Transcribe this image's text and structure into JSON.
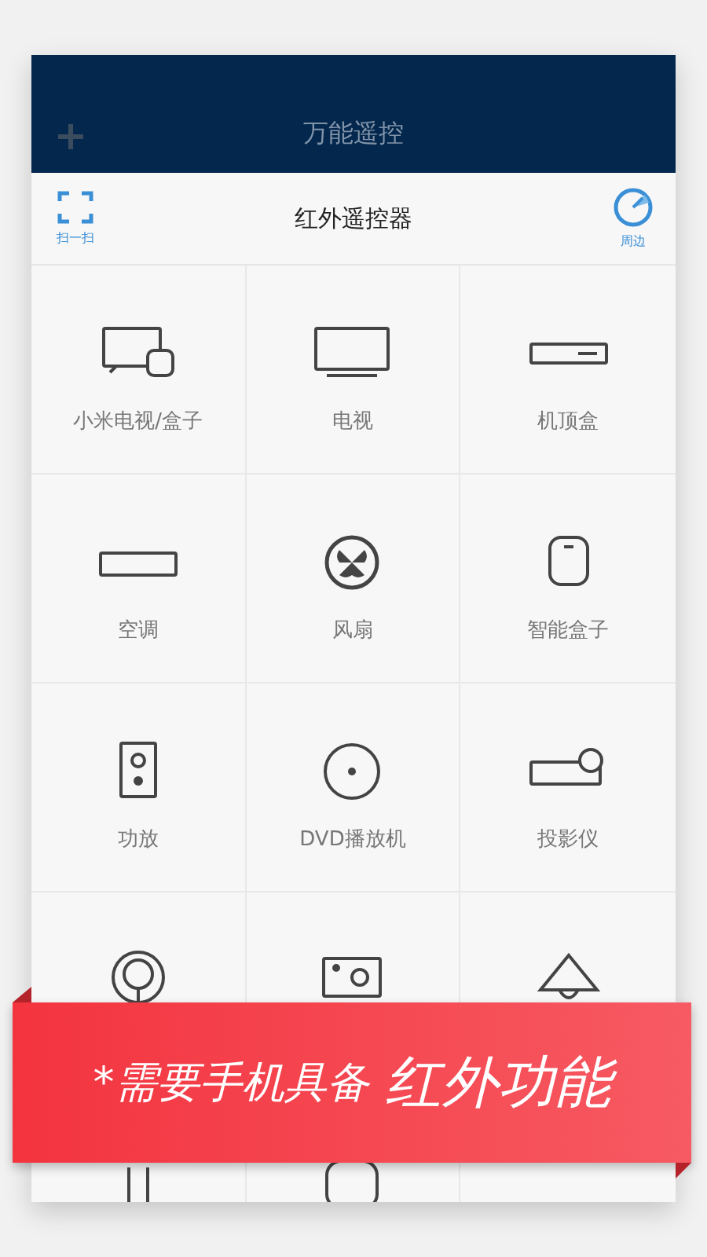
{
  "header": {
    "title": "万能遥控"
  },
  "toolbar": {
    "scan_label": "扫一扫",
    "title": "红外遥控器",
    "nearby_label": "周边"
  },
  "devices": [
    {
      "kind": "tv-box",
      "label": "小米电视/盒子"
    },
    {
      "kind": "tv",
      "label": "电视"
    },
    {
      "kind": "set-top-box",
      "label": "机顶盒"
    },
    {
      "kind": "air-conditioner",
      "label": "空调"
    },
    {
      "kind": "fan",
      "label": "风扇"
    },
    {
      "kind": "smart-box",
      "label": "智能盒子"
    },
    {
      "kind": "speaker",
      "label": "功放"
    },
    {
      "kind": "dvd",
      "label": "DVD播放机"
    },
    {
      "kind": "projector",
      "label": "投影仪"
    },
    {
      "kind": "bulb"
    },
    {
      "kind": "camera"
    },
    {
      "kind": "lamp"
    },
    {
      "kind": "pillar"
    },
    {
      "kind": "pad"
    },
    {
      "kind": "blank"
    }
  ],
  "banner": {
    "note": "*需要手机具备",
    "highlight": "红外功能"
  }
}
